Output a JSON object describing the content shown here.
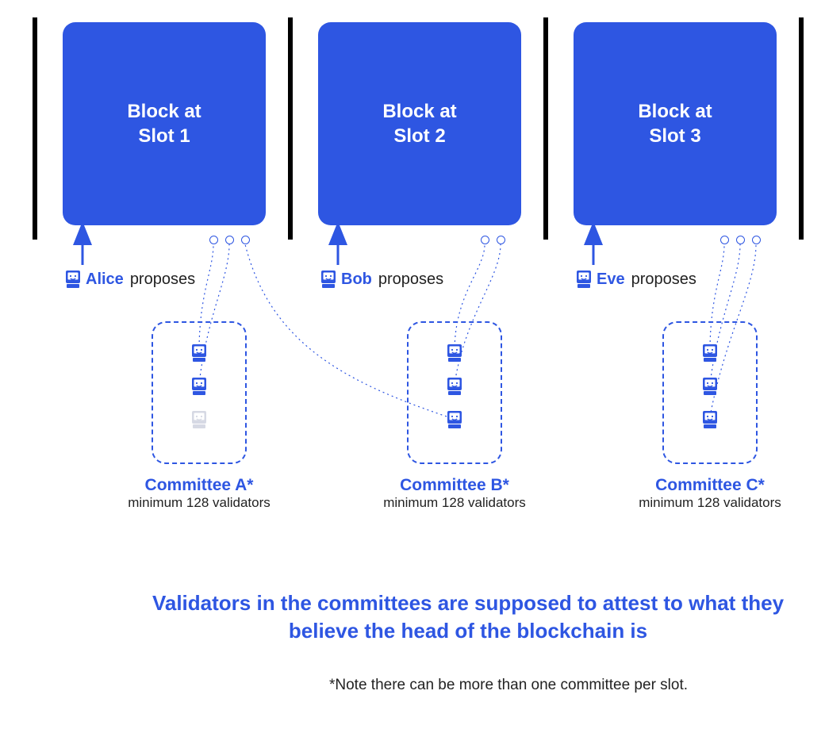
{
  "slots": [
    {
      "block_label": "Block at\nSlot 1",
      "proposer": "Alice",
      "action": "proposes"
    },
    {
      "block_label": "Block at\nSlot 2",
      "proposer": "Bob",
      "action": "proposes"
    },
    {
      "block_label": "Block at\nSlot 3",
      "proposer": "Eve",
      "action": "proposes"
    }
  ],
  "committees": [
    {
      "name": "Committee A*",
      "sub": "minimum 128 validators",
      "node_colors": [
        "#2E56E2",
        "#2E56E2",
        "#D6D9E4"
      ]
    },
    {
      "name": "Committee B*",
      "sub": "minimum 128 validators",
      "node_colors": [
        "#2E56E2",
        "#2E56E2",
        "#2E56E2"
      ]
    },
    {
      "name": "Committee C*",
      "sub": "minimum 128 validators",
      "node_colors": [
        "#2E56E2",
        "#2E56E2",
        "#2E56E2"
      ]
    }
  ],
  "caption": "Validators in the committees are supposed to attest to what they believe the head of the blockchain is",
  "footnote": "*Note there can be more than one committee per slot.",
  "colors": {
    "primary": "#2E56E2",
    "text": "#222222",
    "muted": "#D6D9E4"
  }
}
